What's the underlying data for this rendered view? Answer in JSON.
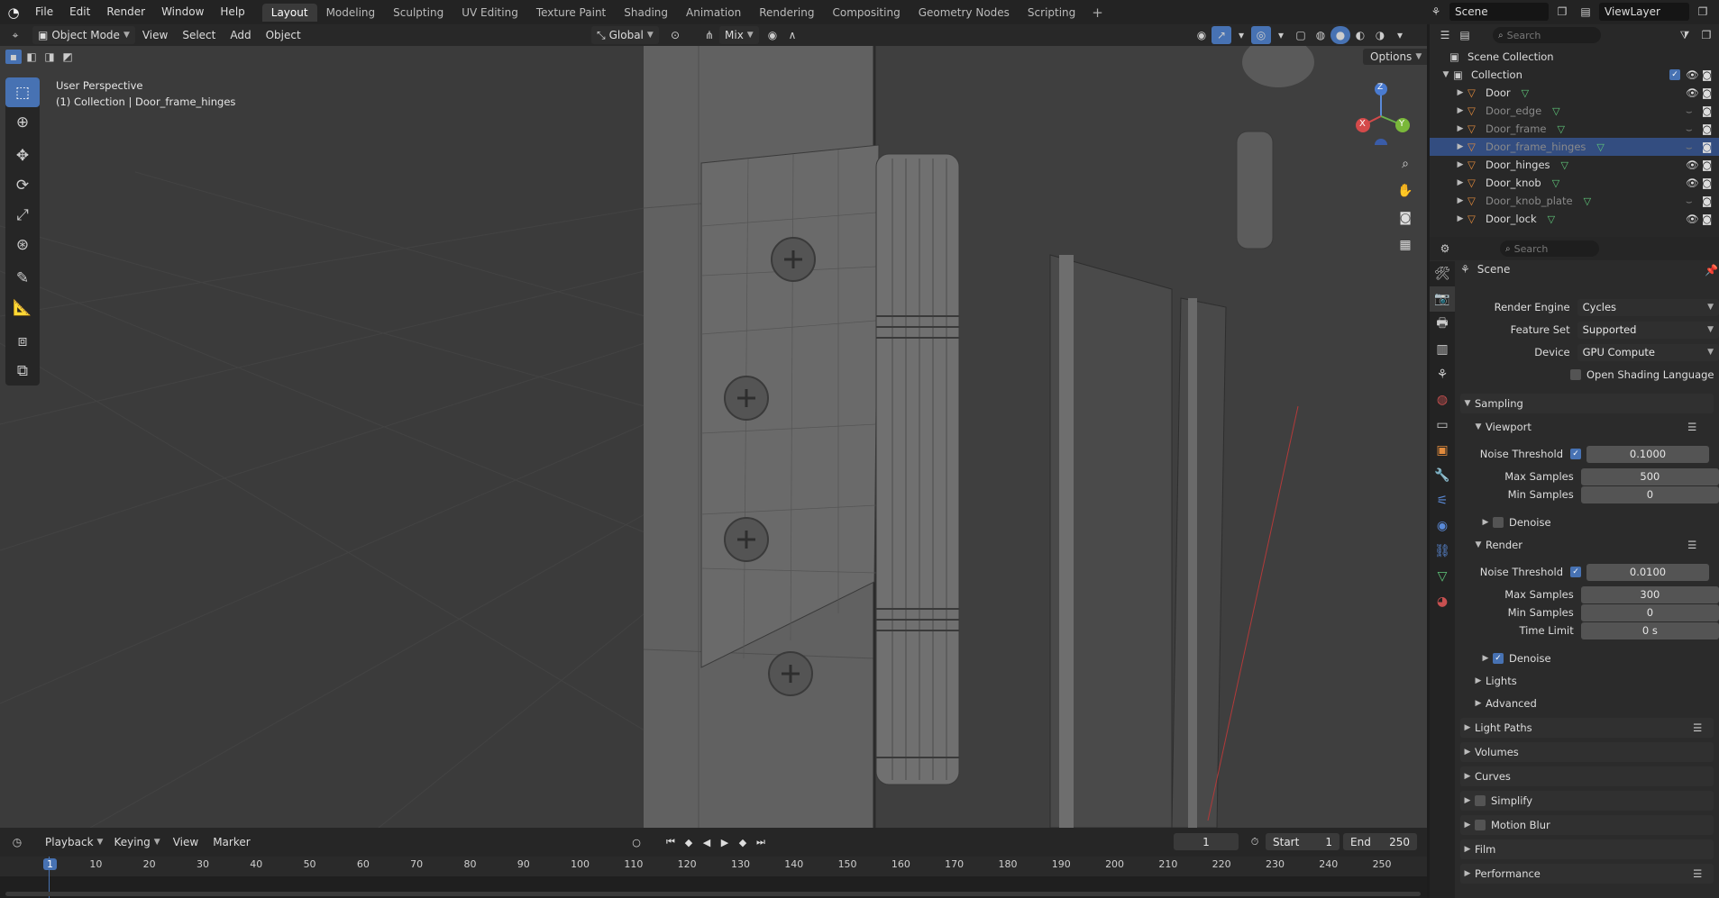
{
  "top_menu": {
    "items": [
      "File",
      "Edit",
      "Render",
      "Window",
      "Help"
    ]
  },
  "workspaces": {
    "tabs": [
      "Layout",
      "Modeling",
      "Sculpting",
      "UV Editing",
      "Texture Paint",
      "Shading",
      "Animation",
      "Rendering",
      "Compositing",
      "Geometry Nodes",
      "Scripting"
    ],
    "active": "Layout",
    "plus": "+"
  },
  "scene": {
    "name": "Scene",
    "view_layer": "ViewLayer"
  },
  "viewport_header": {
    "mode": "Object Mode",
    "menus": [
      "View",
      "Select",
      "Add",
      "Object"
    ],
    "orientation": "Global",
    "blend": "Mix",
    "options": "Options"
  },
  "viewport": {
    "perspective": "User Perspective",
    "selection_info": "(1) Collection | Door_frame_hinges"
  },
  "gizmo": {
    "x": "X",
    "y": "Y",
    "z": "Z"
  },
  "outliner": {
    "search_placeholder": "Search",
    "root": "Scene Collection",
    "collection": "Collection",
    "objects": [
      {
        "name": "Door",
        "visible": true,
        "selected": false
      },
      {
        "name": "Door_edge",
        "visible": false,
        "selected": false
      },
      {
        "name": "Door_frame",
        "visible": false,
        "selected": false
      },
      {
        "name": "Door_frame_hinges",
        "visible": false,
        "selected": true
      },
      {
        "name": "Door_hinges",
        "visible": true,
        "selected": false
      },
      {
        "name": "Door_knob",
        "visible": true,
        "selected": false
      },
      {
        "name": "Door_knob_plate",
        "visible": false,
        "selected": false
      },
      {
        "name": "Door_lock",
        "visible": true,
        "selected": false
      }
    ]
  },
  "properties": {
    "search_placeholder": "Search",
    "context": "Scene",
    "render_engine": {
      "label": "Render Engine",
      "value": "Cycles"
    },
    "feature_set": {
      "label": "Feature Set",
      "value": "Supported"
    },
    "device": {
      "label": "Device",
      "value": "GPU Compute"
    },
    "osl": {
      "label": "Open Shading Language",
      "checked": false
    },
    "sampling": {
      "title": "Sampling",
      "viewport": {
        "title": "Viewport",
        "noise_threshold_label": "Noise Threshold",
        "noise_threshold": "0.1000",
        "max_samples_label": "Max Samples",
        "max_samples": "500",
        "min_samples_label": "Min Samples",
        "min_samples": "0",
        "denoise_label": "Denoise",
        "denoise": false
      },
      "render": {
        "title": "Render",
        "noise_threshold_label": "Noise Threshold",
        "noise_threshold": "0.0100",
        "max_samples_label": "Max Samples",
        "max_samples": "300",
        "min_samples_label": "Min Samples",
        "min_samples": "0",
        "time_limit_label": "Time Limit",
        "time_limit": "0 s",
        "denoise_label": "Denoise",
        "denoise": true
      },
      "lights": "Lights",
      "advanced": "Advanced"
    },
    "panels": [
      "Light Paths",
      "Volumes",
      "Curves",
      "Simplify",
      "Motion Blur",
      "Film",
      "Performance"
    ]
  },
  "timeline": {
    "menus": [
      "Playback",
      "Keying",
      "View",
      "Marker"
    ],
    "current_frame": "1",
    "start_label": "Start",
    "start": "1",
    "end_label": "End",
    "end": "250",
    "ticks": [
      "1",
      "10",
      "20",
      "30",
      "40",
      "50",
      "60",
      "70",
      "80",
      "90",
      "100",
      "110",
      "120",
      "130",
      "140",
      "150",
      "160",
      "170",
      "180",
      "190",
      "200",
      "210",
      "220",
      "230",
      "240",
      "250"
    ]
  },
  "colors": {
    "accent": "#4772b3",
    "selected_row": "#334d80",
    "mesh_orange": "#e08a3c",
    "mesh_green": "#5fc77a"
  }
}
